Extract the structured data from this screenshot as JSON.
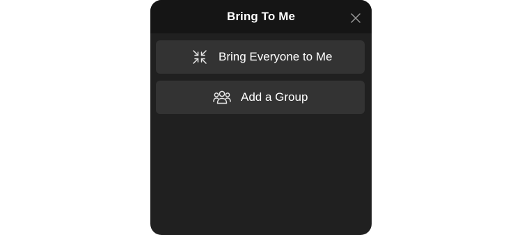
{
  "dialog": {
    "title": "Bring To Me",
    "close_icon": "close-icon"
  },
  "actions": [
    {
      "label": "Bring Everyone to Me",
      "icon": "collapse-arrows-icon"
    },
    {
      "label": "Add a Group",
      "icon": "group-icon"
    }
  ],
  "colors": {
    "panel_background": "#202020",
    "header_background": "#151515",
    "button_background": "#333333",
    "text": "#ffffff"
  }
}
